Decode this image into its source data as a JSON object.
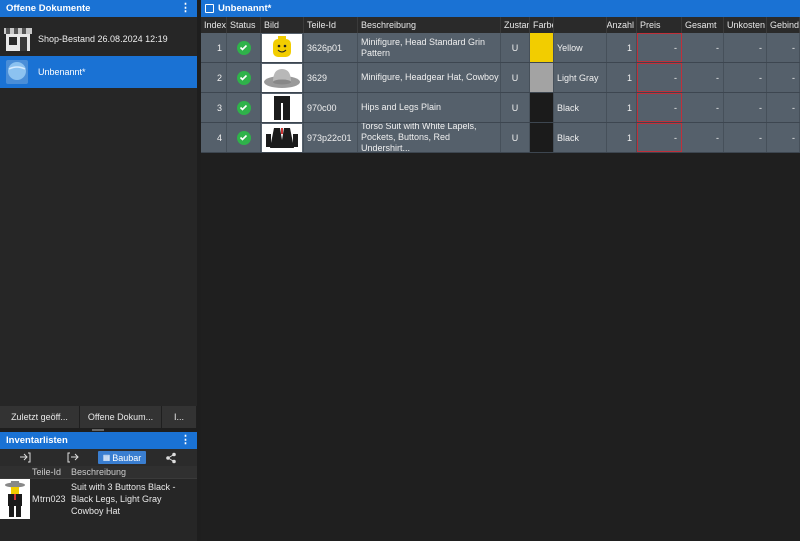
{
  "left_panel": {
    "title": "Offene Dokumente",
    "documents": [
      {
        "label": "Shop-Bestand 26.08.2024 12:19",
        "icon": "store-icon"
      },
      {
        "label": "Unbenannt*",
        "icon": "globe-document-icon"
      }
    ],
    "tabs": [
      "Zuletzt geöff...",
      "Offene Dokum...",
      "I..."
    ]
  },
  "inventory": {
    "title": "Inventarlisten",
    "toolbar": {
      "import_icon": "import-icon",
      "export_icon": "export-icon",
      "buildable_label": "Baubar",
      "share_icon": "share-icon"
    },
    "columns": [
      "Teile-Id",
      "Beschreibung"
    ],
    "rows": [
      {
        "type": "M",
        "id": "trn023",
        "description": "Suit with 3 Buttons Black - Black Legs, Light Gray Cowboy Hat"
      }
    ]
  },
  "document": {
    "title": "Unbenannt*",
    "columns": [
      "Index",
      "Status",
      "Bild",
      "Teile-Id",
      "Beschreibung",
      "Zustan",
      "Farbe",
      "",
      "Anzahl",
      "Preis",
      "Gesamt",
      "Unkosten",
      "Gebinde"
    ],
    "rows": [
      {
        "index": "1",
        "id": "3626p01",
        "description": "Minifigure, Head Standard Grin Pattern",
        "condition": "U",
        "color_name": "Yellow",
        "color_hex": "#f2cd00",
        "qty": "1",
        "price": "-",
        "total": "-",
        "costs": "-",
        "lot": "-"
      },
      {
        "index": "2",
        "id": "3629",
        "description": "Minifigure, Headgear Hat, Cowboy",
        "condition": "U",
        "color_name": "Light Gray",
        "color_hex": "#a3a3a3",
        "qty": "1",
        "price": "-",
        "total": "-",
        "costs": "-",
        "lot": "-"
      },
      {
        "index": "3",
        "id": "970c00",
        "description": "Hips and Legs Plain",
        "condition": "U",
        "color_name": "Black",
        "color_hex": "#1b1b1b",
        "qty": "1",
        "price": "-",
        "total": "-",
        "costs": "-",
        "lot": "-"
      },
      {
        "index": "4",
        "id": "973p22c01",
        "description": "Torso Suit with White Lapels, Pockets, Buttons, Red Undershirt...",
        "condition": "U",
        "color_name": "Black",
        "color_hex": "#1b1b1b",
        "qty": "1",
        "price": "-",
        "total": "-",
        "costs": "-",
        "lot": "-"
      }
    ]
  },
  "colors": {
    "accent": "#1a72d4",
    "row_bg": "#55606b",
    "status_ok": "#2fb24a",
    "price_border": "#c0303a"
  }
}
